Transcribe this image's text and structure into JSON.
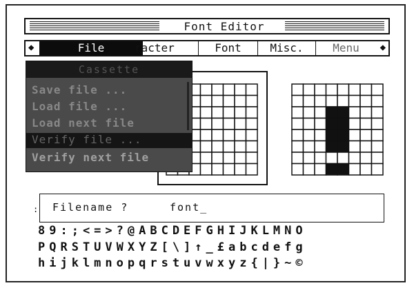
{
  "window": {
    "title": "Font Editor"
  },
  "menubar": {
    "left_arrow": "◆",
    "right_arrow": "◆",
    "items": [
      {
        "label": "File"
      },
      {
        "label": "racter"
      },
      {
        "label": "Font"
      },
      {
        "label": "Misc."
      },
      {
        "label": "Menu"
      }
    ]
  },
  "file_menu": {
    "header": "Cassette",
    "items": [
      {
        "label": "Save file ..."
      },
      {
        "label": "Load file ..."
      },
      {
        "label": "Load next file"
      },
      {
        "label": "Verify file ..."
      },
      {
        "label": "Verify next file"
      }
    ]
  },
  "editor": {
    "edit_grid_cols": 8,
    "edit_grid_rows": 8,
    "preview_grid_cols": 8,
    "preview_grid_rows": 8,
    "preview_filled": [
      [
        3,
        2
      ],
      [
        4,
        2
      ],
      [
        3,
        3
      ],
      [
        4,
        3
      ],
      [
        3,
        4
      ],
      [
        4,
        4
      ],
      [
        3,
        5
      ],
      [
        4,
        5
      ],
      [
        3,
        7
      ],
      [
        4,
        7
      ]
    ]
  },
  "prompt": {
    "label": "Filename ?",
    "value": "font_"
  },
  "charset": {
    "row1": "89:;<=>?@ABCDEFGHIJKLMNO",
    "row2": "PQRSTUVWXYZ[\\]↑_£abcdefg",
    "row3": "hijklmnopqrstuvwxyz{|}~©"
  }
}
